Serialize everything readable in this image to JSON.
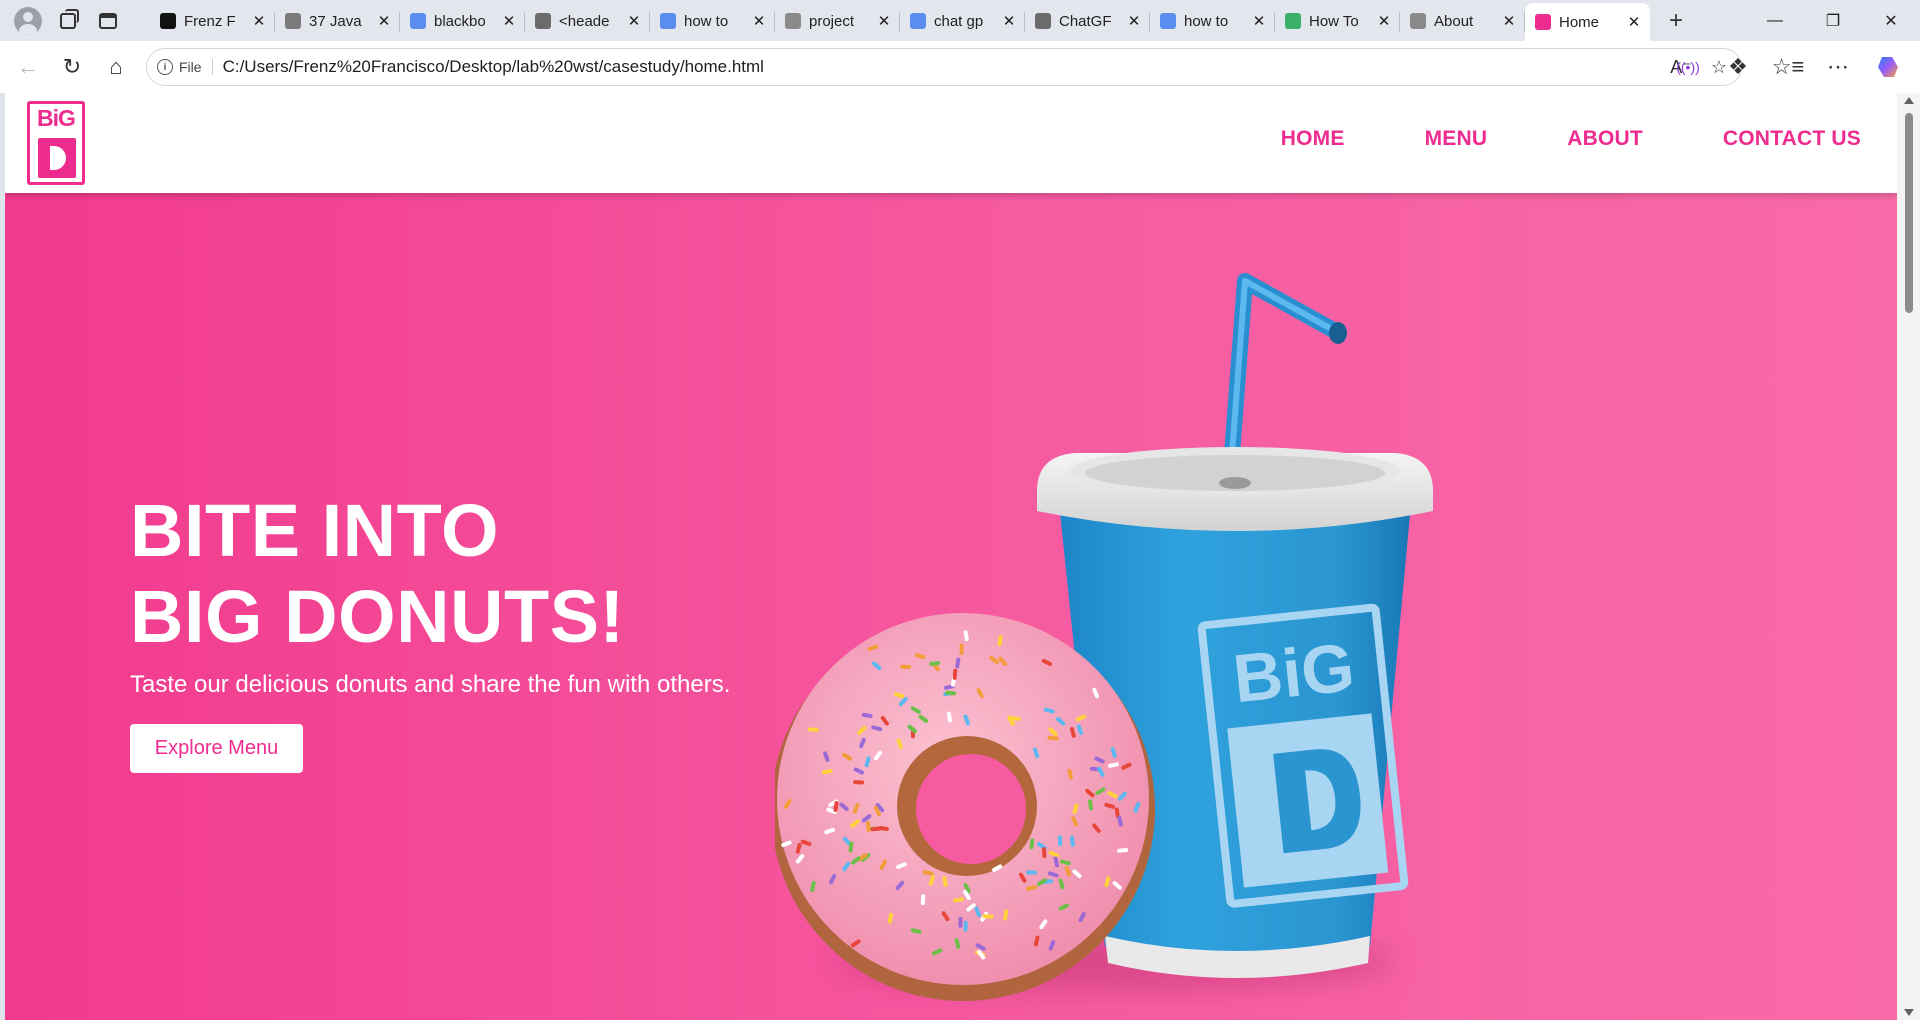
{
  "browser": {
    "tabs": [
      {
        "title": "Frenz F",
        "favicon": "black-square-icon",
        "color": "#111111",
        "active": false
      },
      {
        "title": "37 Java",
        "favicon": "f-doc-icon",
        "color": "#7a7a7a",
        "active": false
      },
      {
        "title": "blackbo",
        "favicon": "search-icon",
        "color": "#5b8def",
        "active": false
      },
      {
        "title": "<heade",
        "favicon": "openai-icon",
        "color": "#6b6b6b",
        "active": false
      },
      {
        "title": "how to",
        "favicon": "search-icon",
        "color": "#5b8def",
        "active": false
      },
      {
        "title": "project",
        "favicon": "doc-icon",
        "color": "#8a8a8a",
        "active": false
      },
      {
        "title": "chat gp",
        "favicon": "search-icon",
        "color": "#5b8def",
        "active": false
      },
      {
        "title": "ChatGF",
        "favicon": "openai-icon",
        "color": "#6b6b6b",
        "active": false
      },
      {
        "title": "how to",
        "favicon": "search-icon",
        "color": "#5b8def",
        "active": false
      },
      {
        "title": "How To",
        "favicon": "w-icon",
        "color": "#3ab06a",
        "active": false
      },
      {
        "title": "About",
        "favicon": "doc-icon",
        "color": "#8a8a8a",
        "active": false
      },
      {
        "title": "Home",
        "favicon": "bigd-icon",
        "color": "#ee2b8e",
        "active": true
      }
    ],
    "address": {
      "scheme_label": "File",
      "url": "C:/Users/Frenz%20Francisco/Desktop/lab%20wst/casestudy/home.html"
    }
  },
  "site": {
    "logo": {
      "text": "BiG",
      "alt": "Big D logo"
    },
    "nav": [
      {
        "label": "HOME"
      },
      {
        "label": "MENU"
      },
      {
        "label": "ABOUT"
      },
      {
        "label": "CONTACT US"
      }
    ],
    "hero": {
      "title_line1": "BITE INTO",
      "title_line2": "BIG DONUTS!",
      "subtitle": "Taste our delicious donuts and share the fun with others.",
      "cta_label": "Explore Menu",
      "cup_text": "BiG"
    },
    "colors": {
      "brand_pink": "#ee2b8e",
      "hero_pink": "#f23a8e",
      "cup_blue": "#2a9ad6",
      "donut_pink": "#f8a5bd"
    }
  }
}
